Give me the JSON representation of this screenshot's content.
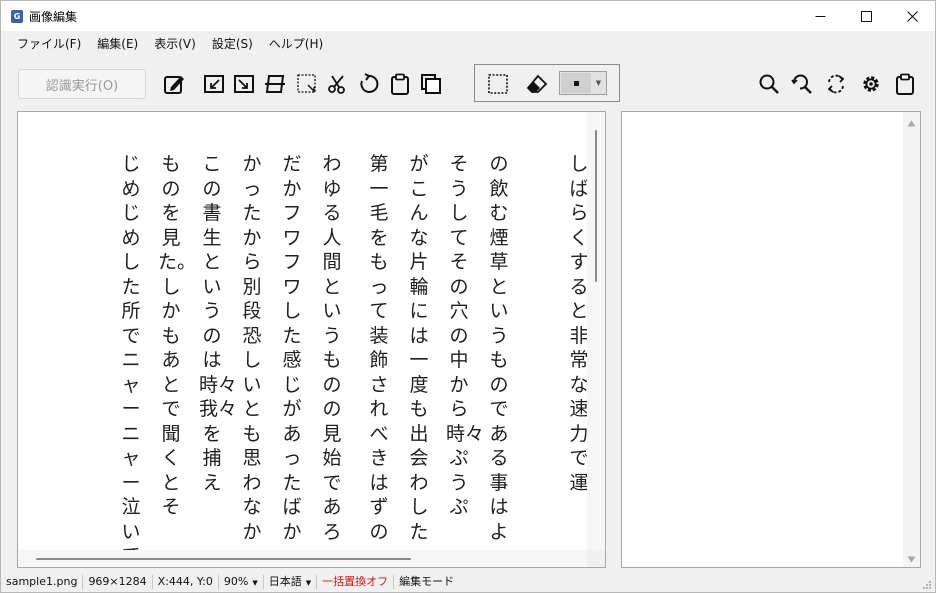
{
  "window": {
    "title": "画像編集",
    "app_icon_letter": "G"
  },
  "menu": [
    {
      "label": "ファイル(F)"
    },
    {
      "label": "編集(E)"
    },
    {
      "label": "表示(V)"
    },
    {
      "label": "設定(S)"
    },
    {
      "label": "ヘルプ(H)"
    }
  ],
  "toolbar": {
    "ocr_button": "認識実行(O)"
  },
  "icons": {
    "app": "app-logo-icon",
    "minimize": "minimize-icon",
    "maximize": "maximize-icon",
    "close": "close-icon",
    "edit": "pencil-icon",
    "rotate_left": "rotate-left-icon",
    "rotate_right": "rotate-right-icon",
    "flip": "flip-icon",
    "crop": "crop-icon",
    "cut": "scissors-icon",
    "rotate": "rotate-icon",
    "paste": "clipboard-icon",
    "copy": "copy-icon",
    "select": "selection-icon",
    "eraser": "eraser-icon",
    "zoom": "zoom-icon",
    "search_replace": "search-replace-icon",
    "refresh": "refresh-icon",
    "settings": "gear-icon",
    "clipboard2": "clipboard-icon"
  },
  "colors": {
    "accent": "#3b5fa8",
    "status_red": "#d01818",
    "brush_color": "#111111"
  },
  "document_text": {
    "columns": [
      "しばらくすると非常な速力で運",
      "の飲む煙草というものである事はよ",
      "そうしてその穴の中から時々ぷうぷ",
      "がこんな片輪には一度も出会わした",
      "第一毛をもって装飾されべきはずの",
      "わゆる人間というものの見始であろ",
      "だかフワフワした感じがあったばか",
      "かったから別段恐しいとも思わなか",
      "この書生というのは時々我々を捕え",
      "ものを見た。しかもあとで聞くとそ",
      "じめじめした所でニャーニャー泣いてい"
    ]
  },
  "status": {
    "filename": "sample1.png",
    "dimensions": "969×1284",
    "cursor": "X:444, Y:0",
    "zoom": "90%",
    "language": "日本語",
    "batch_replace": "一括置換オフ",
    "mode": "編集モード"
  }
}
